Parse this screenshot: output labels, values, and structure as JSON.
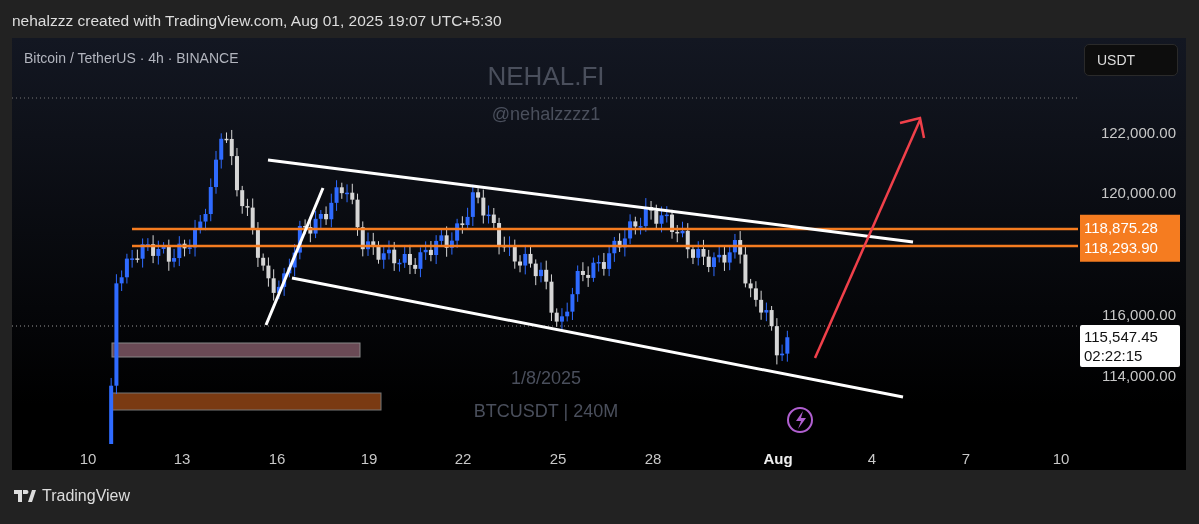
{
  "header": {
    "text": "nehalzzz created with TradingView.com, Aug 01, 2025 19:07 UTC+5:30"
  },
  "chart": {
    "symbol_title": "Bitcoin / TetherUS · 4h · BINANCE",
    "currency_button": "USDT",
    "watermark": {
      "title": "NEHAL.FI",
      "handle": "@nehalzzzz1",
      "date": "1/8/2025",
      "ticker": "BTCUSDT | 240M"
    },
    "price_axis": [
      "122,000.00",
      "120,000.00",
      "116,000.00",
      "114,000.00"
    ],
    "price_line_labels": [
      "118,875.28",
      "118,293.90"
    ],
    "last_price": {
      "price": "115,547.45",
      "countdown": "02:22:15"
    },
    "time_axis": [
      {
        "label": "10",
        "kind": "day"
      },
      {
        "label": "13",
        "kind": "day"
      },
      {
        "label": "16",
        "kind": "day"
      },
      {
        "label": "19",
        "kind": "day"
      },
      {
        "label": "22",
        "kind": "day"
      },
      {
        "label": "25",
        "kind": "day"
      },
      {
        "label": "28",
        "kind": "day"
      },
      {
        "label": "Aug",
        "kind": "month"
      },
      {
        "label": "4",
        "kind": "day"
      },
      {
        "label": "7",
        "kind": "day"
      },
      {
        "label": "10",
        "kind": "day"
      }
    ]
  },
  "footer": {
    "brand": "TradingView"
  }
}
